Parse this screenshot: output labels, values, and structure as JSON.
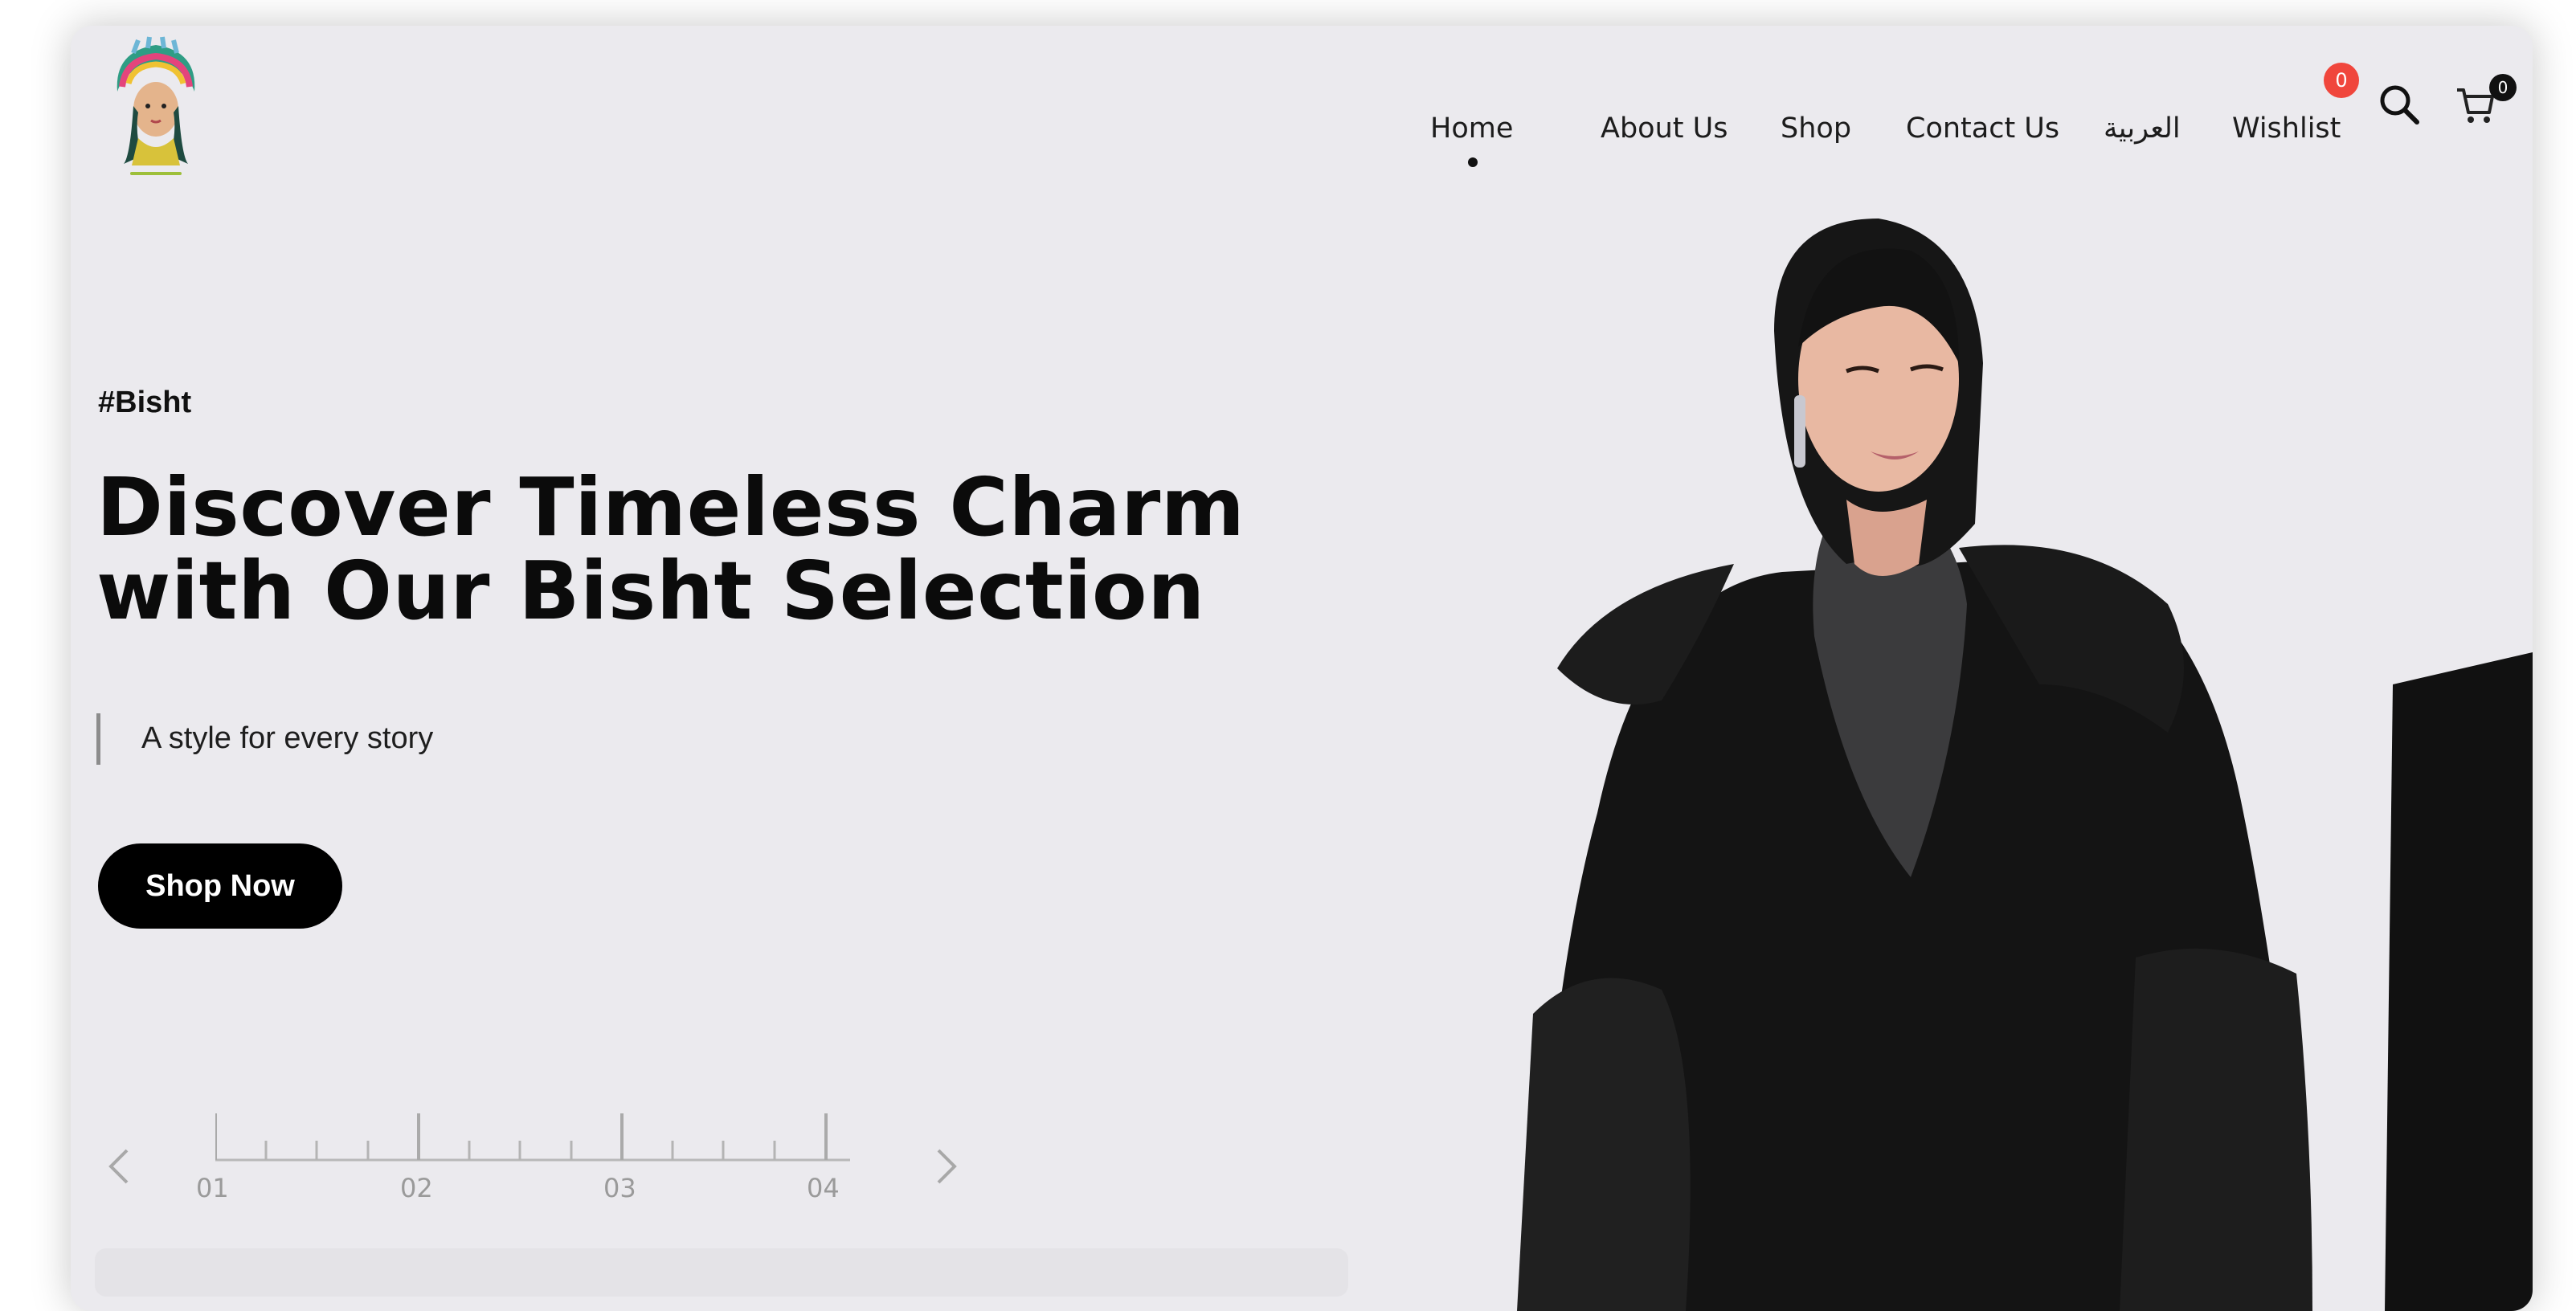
{
  "nav": {
    "items": [
      "Home",
      "About Us",
      "Shop",
      "Contact Us",
      "العربية",
      "Wishlist"
    ],
    "active": "Home",
    "wishlist_count": "0",
    "cart_count": "0",
    "icons": [
      "search-icon",
      "cart-icon"
    ]
  },
  "hero": {
    "tag": "#Bisht",
    "headline_line1": "Discover Timeless Charm",
    "headline_line2": "with Our Bisht Selection",
    "subtitle": "A style for every story",
    "cta": "Shop Now"
  },
  "slider": {
    "steps": [
      "01",
      "02",
      "03",
      "04"
    ],
    "active_step": "01",
    "icons": [
      "chevron-left-icon",
      "chevron-right-icon"
    ]
  },
  "colors": {
    "background": "#ebeaee",
    "text": "#0b0b0b",
    "button": "#000000",
    "badge": "#f0463c"
  }
}
